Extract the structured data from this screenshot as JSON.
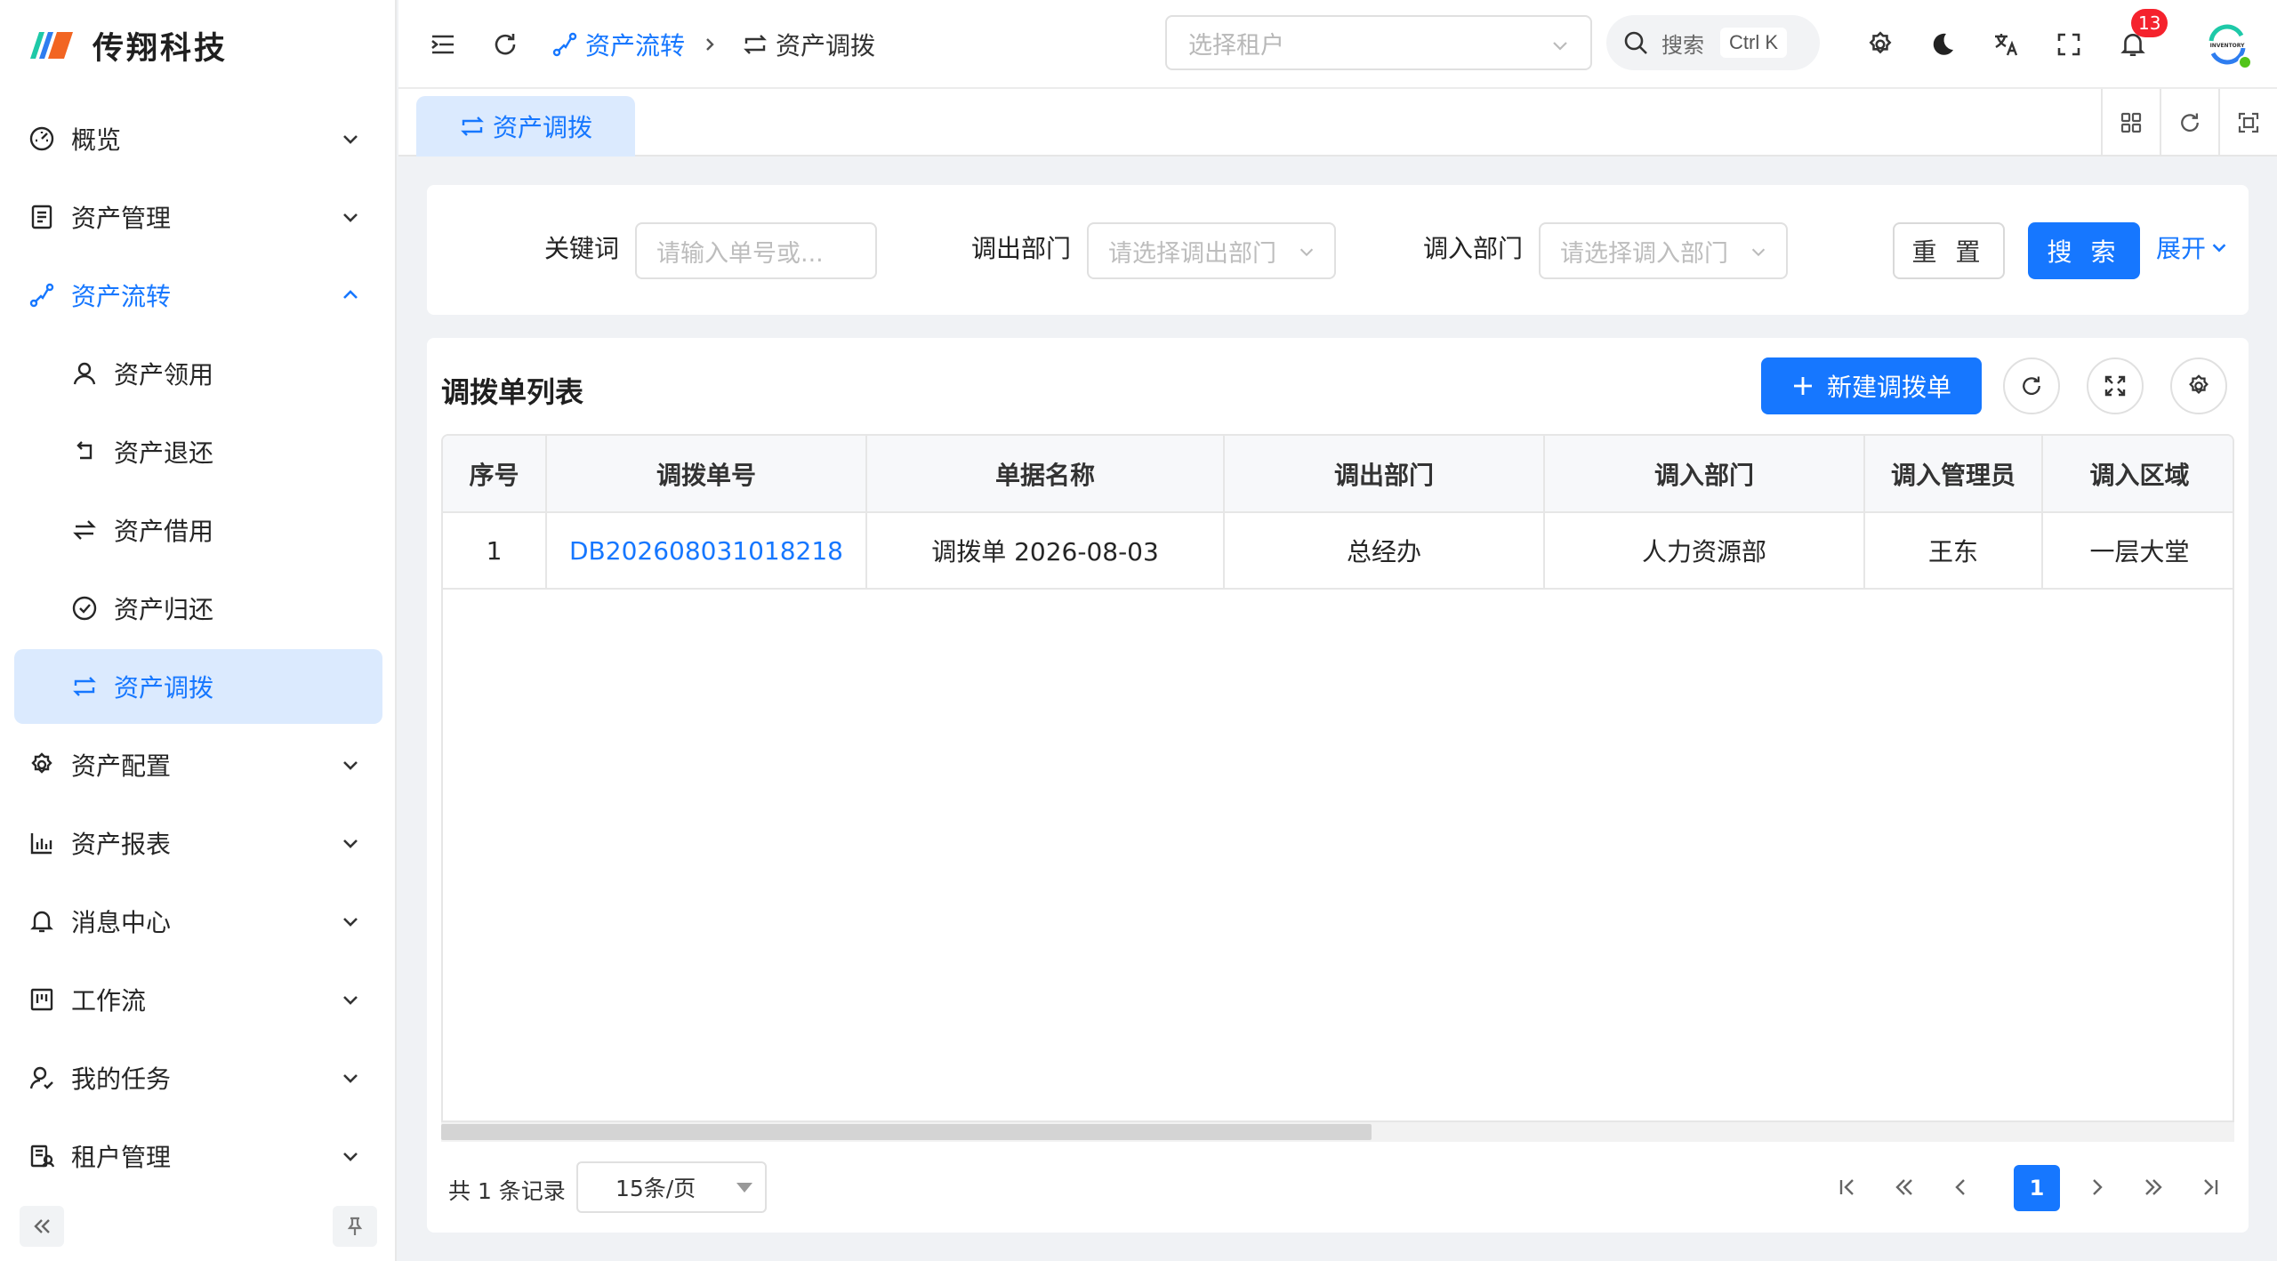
{
  "brand": {
    "name": "传翔科技",
    "colors": [
      "#1ec9a8",
      "#2e7df0",
      "#f26522"
    ]
  },
  "sidebar": {
    "items": [
      {
        "label": "概览",
        "icon": "dashboard-gauge-icon"
      },
      {
        "label": "资产管理",
        "icon": "document-list-icon"
      },
      {
        "label": "资产流转",
        "icon": "flow-icon",
        "expanded": true
      },
      {
        "label": "资产领用",
        "icon": "user-icon"
      },
      {
        "label": "资产退还",
        "icon": "return-arrow-icon"
      },
      {
        "label": "资产借用",
        "icon": "swap-arrows-icon"
      },
      {
        "label": "资产归还",
        "icon": "check-circle-icon"
      },
      {
        "label": "资产调拨",
        "icon": "transfer-icon",
        "active": true
      },
      {
        "label": "资产配置",
        "icon": "gear-icon"
      },
      {
        "label": "资产报表",
        "icon": "bar-chart-icon"
      },
      {
        "label": "消息中心",
        "icon": "bell-icon"
      },
      {
        "label": "工作流",
        "icon": "kanban-icon"
      },
      {
        "label": "我的任务",
        "icon": "user-task-icon"
      },
      {
        "label": "租户管理",
        "icon": "tenant-icon"
      }
    ]
  },
  "header": {
    "breadcrumb": [
      "资产流转",
      "资产调拨"
    ],
    "tenant_placeholder": "选择租户",
    "search_label": "搜索",
    "search_shortcut": "Ctrl K",
    "notification_count": "13",
    "avatar_text": "INVENTORY"
  },
  "tabs": [
    {
      "label": "资产调拨"
    }
  ],
  "filters": {
    "keyword_label": "关键词",
    "keyword_placeholder": "请输入单号或...",
    "out_dept_label": "调出部门",
    "out_dept_placeholder": "请选择调出部门",
    "in_dept_label": "调入部门",
    "in_dept_placeholder": "请选择调入部门",
    "reset_label": "重 置",
    "search_label": "搜 索",
    "expand_label": "展开"
  },
  "table": {
    "title": "调拨单列表",
    "new_button": "新建调拨单",
    "columns": [
      "序号",
      "调拨单号",
      "单据名称",
      "调出部门",
      "调入部门",
      "调入管理员",
      "调入区域"
    ],
    "rows": [
      [
        "1",
        "DB202608031018218",
        "调拨单 2026-08-03",
        "总经办",
        "人力资源部",
        "王东",
        "一层大堂"
      ]
    ]
  },
  "pagination": {
    "total_text": "共 1 条记录",
    "page_size": "15条/页",
    "current_page": "1"
  },
  "colors": {
    "primary": "#1677ff",
    "active_bg": "#dbeafe",
    "badge": "#f5222d"
  }
}
